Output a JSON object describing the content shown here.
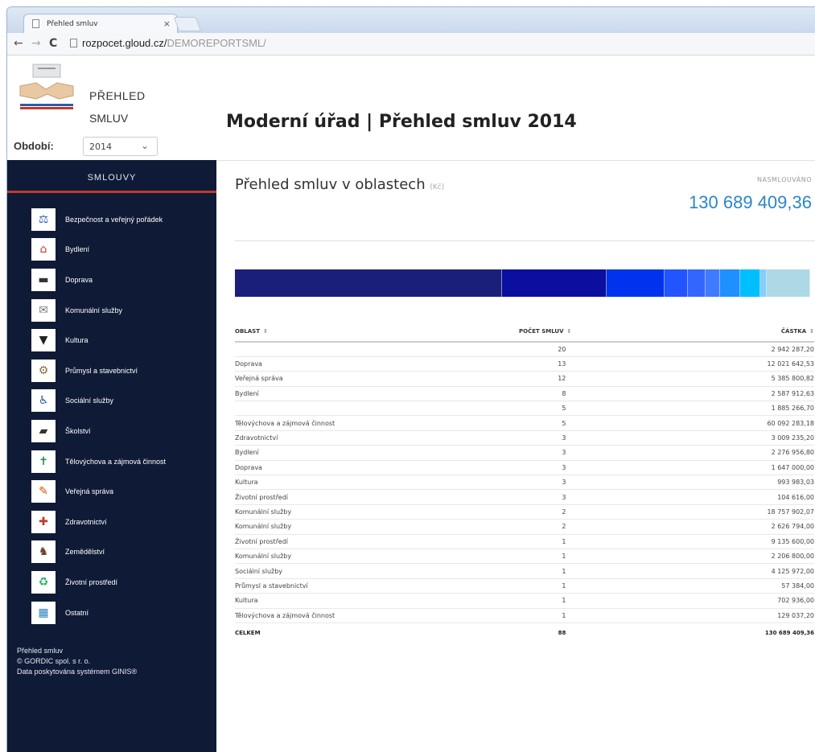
{
  "browser": {
    "tab_title": "Přehled smluv",
    "url_host": "rozpocet.gloud.cz/",
    "url_path": "DEMOREPORTSML/"
  },
  "brand": {
    "title_line1": "PŘEHLED",
    "title_line2": "SMLUV"
  },
  "period": {
    "label": "Období:",
    "value": "2014"
  },
  "page_title": "Moderní úřad | Přehled smluv  2014",
  "sidebar": {
    "heading": "SMLOUVY",
    "items": [
      {
        "label": "Bezpečnost a veřejný pořádek",
        "icon": "security-icon",
        "glyph": "⚖",
        "color": "#2a5db0"
      },
      {
        "label": "Bydlení",
        "icon": "house-icon",
        "glyph": "⌂",
        "color": "#c0392b"
      },
      {
        "label": "Doprava",
        "icon": "transport-icon",
        "glyph": "▬",
        "color": "#333"
      },
      {
        "label": "Komunální služby",
        "icon": "municipal-icon",
        "glyph": "✉",
        "color": "#777"
      },
      {
        "label": "Kultura",
        "icon": "culture-icon",
        "glyph": "▼",
        "color": "#222"
      },
      {
        "label": "Průmysl a stavebnictví",
        "icon": "industry-icon",
        "glyph": "⚙",
        "color": "#8a6d3b"
      },
      {
        "label": "Sociální služby",
        "icon": "social-icon",
        "glyph": "♿",
        "color": "#2a5db0"
      },
      {
        "label": "Školství",
        "icon": "education-icon",
        "glyph": "▰",
        "color": "#333"
      },
      {
        "label": "Tělovýchova a zájmová činnost",
        "icon": "sport-icon",
        "glyph": "✝",
        "color": "#2e8b57"
      },
      {
        "label": "Veřejná správa",
        "icon": "administration-icon",
        "glyph": "✎",
        "color": "#d35400"
      },
      {
        "label": "Zdravotnictví",
        "icon": "health-icon",
        "glyph": "✚",
        "color": "#c0392b"
      },
      {
        "label": "Zemědělství",
        "icon": "agriculture-icon",
        "glyph": "♞",
        "color": "#6b4226"
      },
      {
        "label": "Životní prostředí",
        "icon": "environment-icon",
        "glyph": "♻",
        "color": "#27ae60"
      },
      {
        "label": "Ostatní",
        "icon": "other-icon",
        "glyph": "▦",
        "color": "#2980b9"
      }
    ],
    "footer_line1": "Přehled smluv",
    "footer_line2": "© GORDIC spol. s r. o.",
    "footer_line3": "Data poskytována systémem GINIS®"
  },
  "main": {
    "title": "Přehled smluv v oblastech",
    "title_unit": "(Kč)",
    "negotiated_label": "NASMLOUVÁNO",
    "negotiated_value": "130 689 409,36",
    "bar_segments": [
      {
        "share": 0.46,
        "color": "#1a1f7a"
      },
      {
        "share": 0.18,
        "color": "#0a0fa0"
      },
      {
        "share": 0.1,
        "color": "#0033ee"
      },
      {
        "share": 0.04,
        "color": "#2255ff"
      },
      {
        "share": 0.03,
        "color": "#3366ff"
      },
      {
        "share": 0.025,
        "color": "#3f7bff"
      },
      {
        "share": 0.035,
        "color": "#1e90ff"
      },
      {
        "share": 0.035,
        "color": "#00bfff"
      },
      {
        "share": 0.01,
        "color": "#87cefa"
      },
      {
        "share": 0.075,
        "color": "#add8e6"
      }
    ],
    "table": {
      "col_area": "OBLAST",
      "col_count": "POČET SMLUV",
      "col_amount": "ČÁSTKA",
      "rows": [
        {
          "area": "",
          "count": "20",
          "amount": "2 942 287,20"
        },
        {
          "area": "Doprava",
          "count": "13",
          "amount": "12 021 642,53"
        },
        {
          "area": "Veřejná správa",
          "count": "12",
          "amount": "5 385 800,82"
        },
        {
          "area": "Bydlení",
          "count": "8",
          "amount": "2 587 912,63"
        },
        {
          "area": "",
          "count": "5",
          "amount": "1 885 266,70"
        },
        {
          "area": "Tělovýchova a zájmová činnost",
          "count": "5",
          "amount": "60 092 283,18"
        },
        {
          "area": "Zdravotnictví",
          "count": "3",
          "amount": "3 009 235,20"
        },
        {
          "area": "Bydlení",
          "count": "3",
          "amount": "2 276 956,80"
        },
        {
          "area": "Doprava",
          "count": "3",
          "amount": "1 647 000,00"
        },
        {
          "area": "Kultura",
          "count": "3",
          "amount": "993 983,03"
        },
        {
          "area": "Životní prostředí",
          "count": "3",
          "amount": "104 616,00"
        },
        {
          "area": "Komunální služby",
          "count": "2",
          "amount": "18 757 902,07"
        },
        {
          "area": "Komunální služby",
          "count": "2",
          "amount": "2 626 794,00"
        },
        {
          "area": "Životní prostředí",
          "count": "1",
          "amount": "9 135 600,00"
        },
        {
          "area": "Komunální služby",
          "count": "1",
          "amount": "2 206 800,00"
        },
        {
          "area": "Sociální služby",
          "count": "1",
          "amount": "4 125 972,00"
        },
        {
          "area": "Průmysl a stavebnictví",
          "count": "1",
          "amount": "57 384,00"
        },
        {
          "area": "Kultura",
          "count": "1",
          "amount": "702 936,00"
        },
        {
          "area": "Tělovýchova a zájmová činnost",
          "count": "1",
          "amount": "129 037,20"
        }
      ],
      "total_label": "CELKEM",
      "total_count": "88",
      "total_amount": "130 689 409,36"
    }
  }
}
